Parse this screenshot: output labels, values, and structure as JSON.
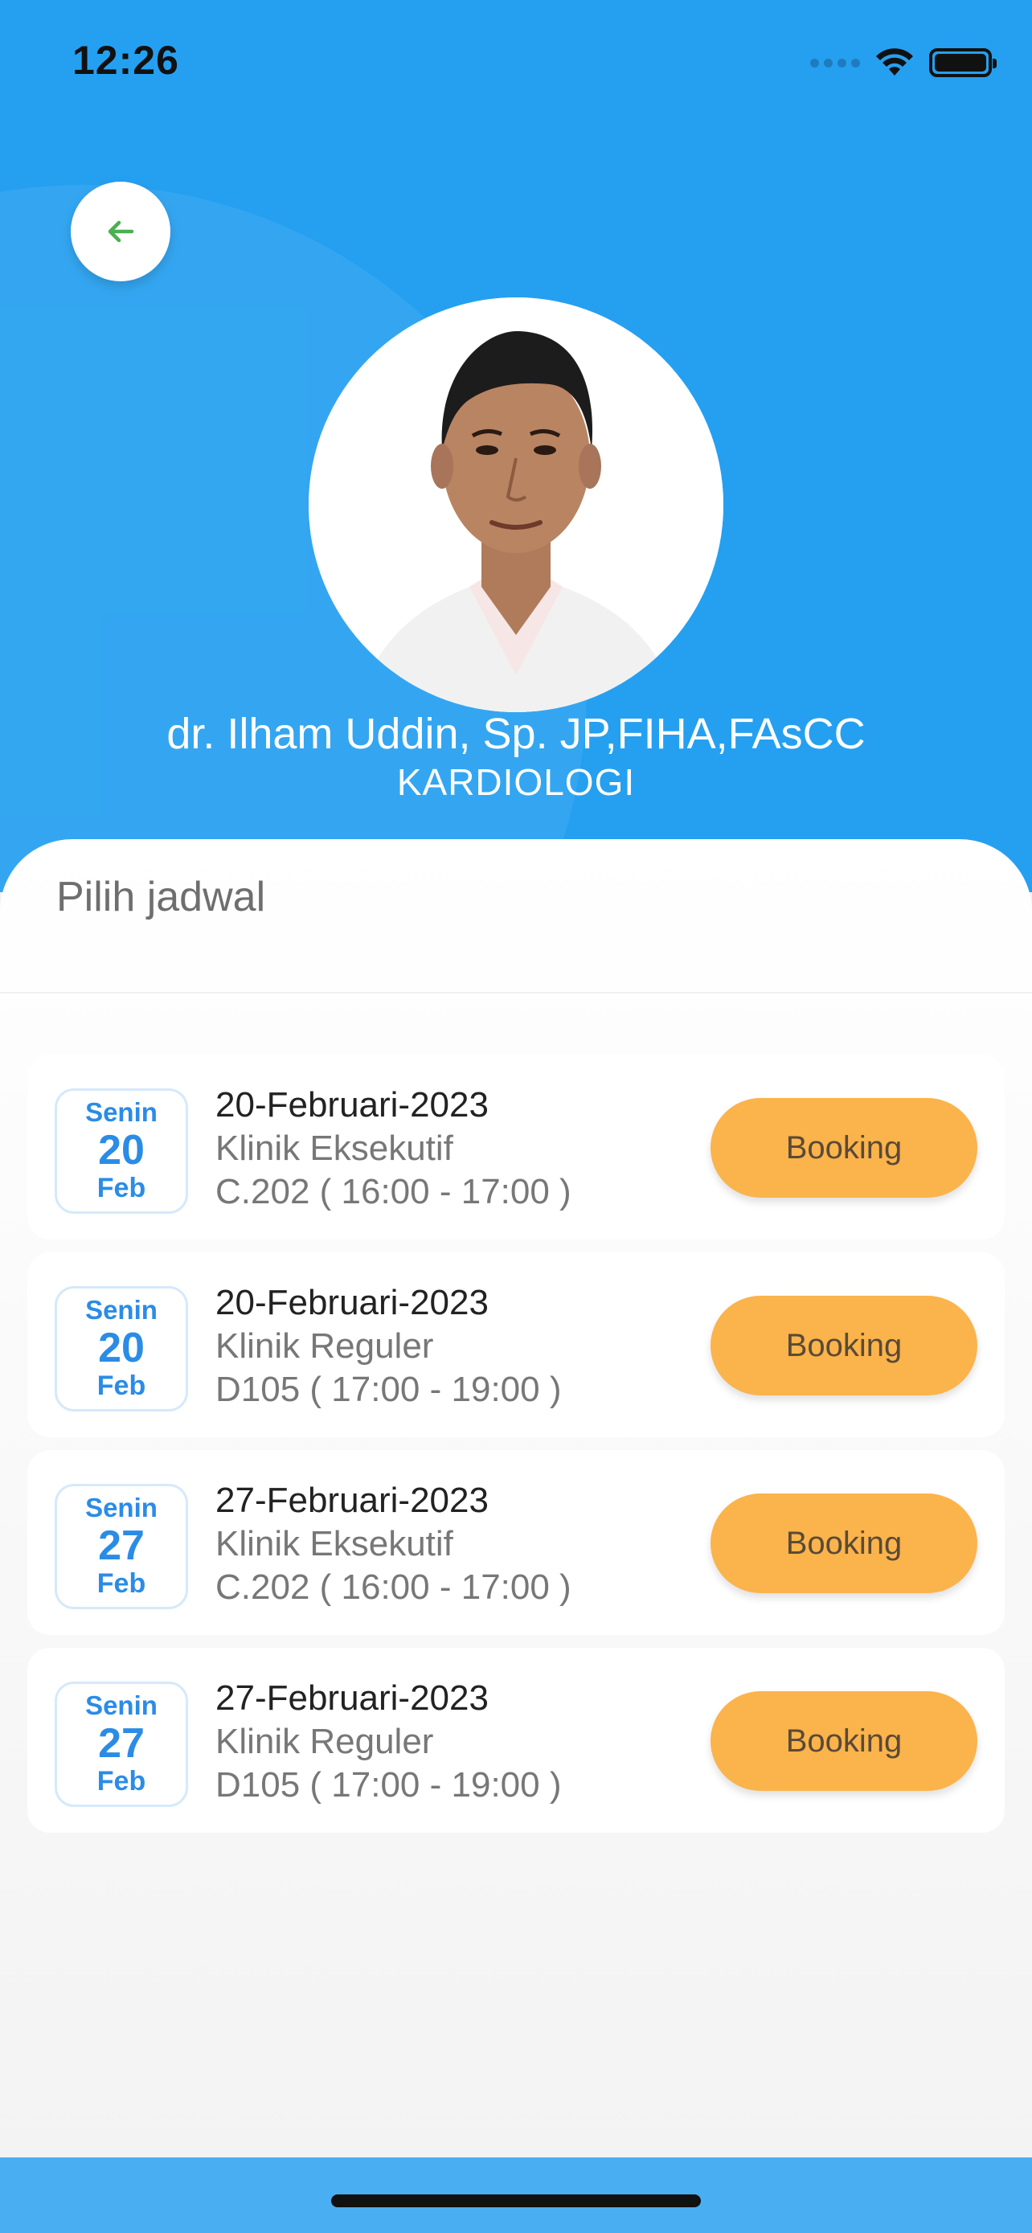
{
  "status_bar": {
    "time": "12:26"
  },
  "doctor": {
    "name": "dr. Ilham Uddin, Sp. JP,FIHA,FAsCC",
    "specialty": "KARDIOLOGI"
  },
  "schedule": {
    "title": "Pilih jadwal",
    "items": [
      {
        "day": "Senin",
        "date_num": "20",
        "month": "Feb",
        "date": "20-Februari-2023",
        "clinic": "Klinik Eksekutif",
        "room_time": "C.202 ( 16:00 - 17:00 )",
        "button": "Booking"
      },
      {
        "day": "Senin",
        "date_num": "20",
        "month": "Feb",
        "date": "20-Februari-2023",
        "clinic": "Klinik Reguler",
        "room_time": "D105 ( 17:00 - 19:00 )",
        "button": "Booking"
      },
      {
        "day": "Senin",
        "date_num": "27",
        "month": "Feb",
        "date": "27-Februari-2023",
        "clinic": "Klinik Eksekutif",
        "room_time": "C.202 ( 16:00 - 17:00 )",
        "button": "Booking"
      },
      {
        "day": "Senin",
        "date_num": "27",
        "month": "Feb",
        "date": "27-Februari-2023",
        "clinic": "Klinik Reguler",
        "room_time": "D105 ( 17:00 - 19:00 )",
        "button": "Booking"
      }
    ]
  },
  "colors": {
    "header_blue": "#25a0f0",
    "booking_orange": "#fbb34c",
    "date_blue": "#2b8ce6",
    "back_arrow_green": "#4caf50"
  },
  "icons": {
    "back": "arrow-left-icon",
    "wifi": "wifi-icon",
    "battery": "battery-icon",
    "signal": "signal-icon"
  }
}
